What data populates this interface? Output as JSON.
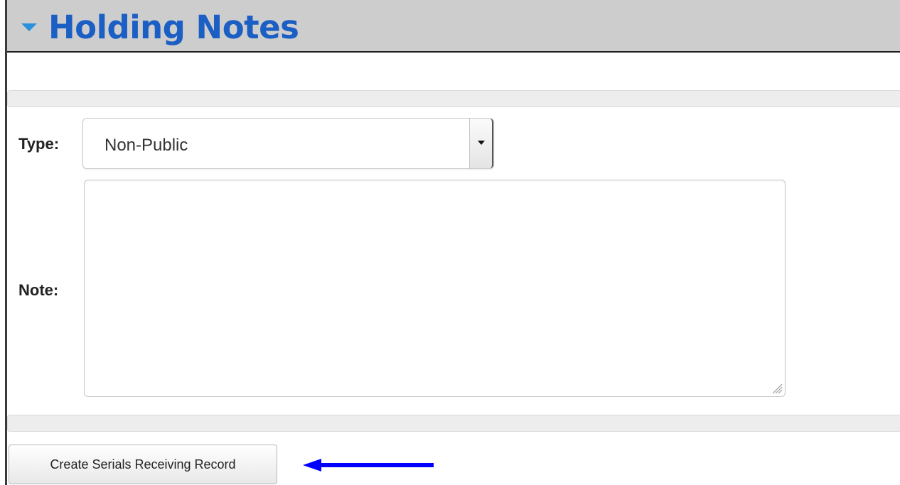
{
  "section": {
    "title": "Holding Notes",
    "collapse_icon": "triangle-down-icon",
    "header_color": "#cdcdcd",
    "title_color": "#1b5fc4"
  },
  "form": {
    "type_label": "Type:",
    "type_value": "Non-Public",
    "note_label": "Note:",
    "note_value": ""
  },
  "actions": {
    "create_label": "Create Serials Receiving Record"
  },
  "annotation": {
    "arrow_icon": "left-arrow-icon",
    "arrow_color": "#0000ff"
  }
}
